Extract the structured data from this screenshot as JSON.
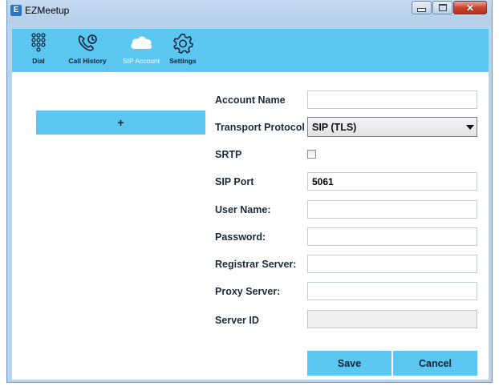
{
  "window": {
    "title": "EZMeetup",
    "app_icon_glyph": "E",
    "close_glyph": "✕"
  },
  "toolbar": {
    "items": [
      {
        "label": "Dial",
        "icon": "dialpad-icon",
        "active": false
      },
      {
        "label": "Call History",
        "icon": "phone-history-icon",
        "active": false
      },
      {
        "label": "SIP Account",
        "icon": "cloud-icon",
        "active": true
      },
      {
        "label": "Settings",
        "icon": "gear-icon",
        "active": false
      }
    ]
  },
  "accounts": {
    "add_label": "+"
  },
  "form": {
    "account_name_label": "Account Name",
    "account_name_value": "",
    "transport_label": "Transport Protocol",
    "transport_value": "SIP (TLS)",
    "srtp_label": "SRTP",
    "srtp_checked": false,
    "sip_port_label": "SIP Port",
    "sip_port_value": "5061",
    "user_name_label": "User Name:",
    "user_name_value": "",
    "password_label": "Password:",
    "password_value": "",
    "registrar_label": "Registrar Server:",
    "registrar_value": "",
    "proxy_label": "Proxy Server:",
    "proxy_value": "",
    "server_id_label": "Server ID",
    "server_id_value": ""
  },
  "actions": {
    "save_label": "Save",
    "cancel_label": "Cancel"
  },
  "colors": {
    "accent": "#5bc6ef",
    "titlebar": "#b9d1ea",
    "close_button": "#c9452f"
  }
}
